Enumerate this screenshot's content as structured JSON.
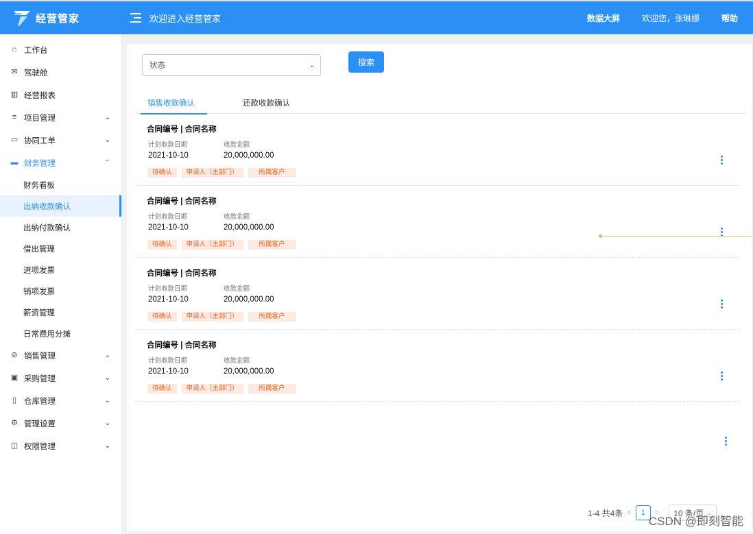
{
  "header": {
    "app_name": "经营管家",
    "welcome_title": "欢迎进入经营管家",
    "data_screen": "数据大屏",
    "greeting": "欢迎您，张琳娜",
    "help": "帮助"
  },
  "sidebar": {
    "items": [
      {
        "label": "工作台",
        "icon": "home-icon"
      },
      {
        "label": "驾驶舱",
        "icon": "mail-icon"
      },
      {
        "label": "经营报表",
        "icon": "chart-icon"
      },
      {
        "label": "项目管理",
        "icon": "list-icon"
      },
      {
        "label": "协同工单",
        "icon": "message-icon"
      },
      {
        "label": "财务管理",
        "icon": "wallet-icon"
      }
    ],
    "finance_sub": [
      "财务看板",
      "出纳收款确认",
      "出纳付款确认",
      "借出管理",
      "进项发票",
      "销项发票",
      "薪资管理",
      "日常费用分摊"
    ],
    "items_after": [
      {
        "label": "销售管理",
        "icon": "sales-icon"
      },
      {
        "label": "采购管理",
        "icon": "gift-icon"
      },
      {
        "label": "仓库管理",
        "icon": "warehouse-icon"
      },
      {
        "label": "管理设置",
        "icon": "gear-icon"
      },
      {
        "label": "权限管理",
        "icon": "lock-icon"
      }
    ]
  },
  "filter": {
    "status_placeholder": "状态",
    "search_label": "搜索"
  },
  "tabs": [
    "销售收款确认",
    "还款收款确认"
  ],
  "cards": [
    {
      "title": "合同编号 | 合同名称",
      "date_label": "计划收款日期",
      "date": "2021-10-10",
      "amount_label": "收款金额",
      "amount": "20,000,000.00",
      "tags": [
        "待确认",
        "申请人（主部门）",
        "所属客户"
      ]
    },
    {
      "title": "合同编号 | 合同名称",
      "date_label": "计划收款日期",
      "date": "2021-10-10",
      "amount_label": "收款金额",
      "amount": "20,000,000.00",
      "tags": [
        "待确认",
        "申请人（主部门）",
        "所属客户"
      ]
    },
    {
      "title": "合同编号 | 合同名称",
      "date_label": "计划收款日期",
      "date": "2021-10-10",
      "amount_label": "收款金额",
      "amount": "20,000,000.00",
      "tags": [
        "待确认",
        "申请人（主部门）",
        "所属客户"
      ]
    },
    {
      "title": "合同编号 | 合同名称",
      "date_label": "计划收款日期",
      "date": "2021-10-10",
      "amount_label": "收款金额",
      "amount": "20,000,000.00",
      "tags": [
        "待确认",
        "申请人（主部门）",
        "所属客户"
      ]
    }
  ],
  "pagination": {
    "summary": "1-4 共4条",
    "current_page": "1",
    "page_size": "10 条/页"
  },
  "watermark": "CSDN @即刻智能",
  "colors": {
    "primary": "#2b90f5",
    "tag_bg": "#fde9df",
    "tag_text": "#e8652a"
  }
}
